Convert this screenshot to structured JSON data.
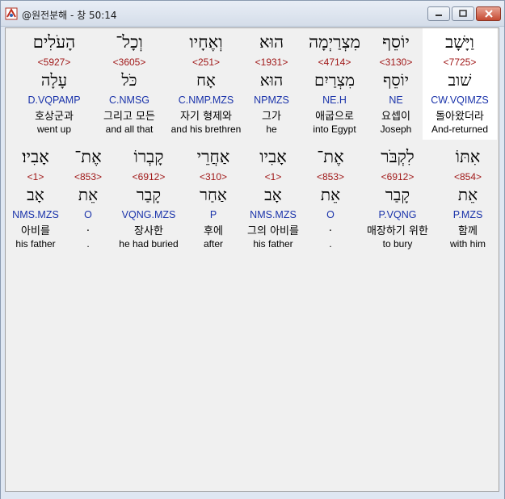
{
  "window": {
    "title": "@원전분해 - 창 50:14",
    "icon": "app-icon",
    "buttons": [
      "minimize",
      "maximize",
      "close"
    ]
  },
  "rows": [
    {
      "cells": [
        {
          "hebrew": "וַיָּשָׁב",
          "strong": "<7725>",
          "lemma": "שׁוב",
          "morph": "CW.VQIMZS",
          "korean": "돌아왔더라",
          "english": "And-returned",
          "selected": true
        },
        {
          "hebrew": "יוֹסֵף",
          "strong": "<3130>",
          "lemma": "יוֹסֵף",
          "morph": "NE",
          "korean": "요셉이",
          "english": "Joseph",
          "selected": false
        },
        {
          "hebrew": "מִצְרַיְמָה",
          "strong": "<4714>",
          "lemma": "מִצְרַיִם",
          "morph": "NE.H",
          "korean": "애굽으로",
          "english": "into Egypt",
          "selected": false
        },
        {
          "hebrew": "הוּא",
          "strong": "<1931>",
          "lemma": "הוּא",
          "morph": "NPMZS",
          "korean": "그가",
          "english": "he",
          "selected": false
        },
        {
          "hebrew": "וְאֶחָיו",
          "strong": "<251>",
          "lemma": "אָח",
          "morph": "C.NMP.MZS",
          "korean": "자기 형제와",
          "english": "and his brethren",
          "selected": false
        },
        {
          "hebrew": "וְכָל־",
          "strong": "<3605>",
          "lemma": "כֹּל",
          "morph": "C.NMSG",
          "korean": "그리고 모든",
          "english": "and all that",
          "selected": false
        },
        {
          "hebrew": "הָעֹלִים",
          "strong": "<5927>",
          "lemma": "עָלָה",
          "morph": "D.VQPAMP",
          "korean": "호상군과",
          "english": "went up",
          "selected": false
        }
      ]
    },
    {
      "cells": [
        {
          "hebrew": "אִתּוֹ",
          "strong": "<854>",
          "lemma": "אֵת",
          "morph": "P.MZS",
          "korean": "함께",
          "english": "with him",
          "selected": false
        },
        {
          "hebrew": "לִקְבֹּר",
          "strong": "<6912>",
          "lemma": "קָבַר",
          "morph": "P.VQNG",
          "korean": "매장하기 위한",
          "english": "to bury",
          "selected": false
        },
        {
          "hebrew": "אֶת־",
          "strong": "<853>",
          "lemma": "אֵת",
          "morph": "O",
          "korean": ".",
          "english": ".",
          "selected": false
        },
        {
          "hebrew": "אָבִיו",
          "strong": "<1>",
          "lemma": "אָב",
          "morph": "NMS.MZS",
          "korean": "그의 아비를",
          "english": "his father",
          "selected": false
        },
        {
          "hebrew": "אַחֲרֵי",
          "strong": "<310>",
          "lemma": "אַחַר",
          "morph": "P",
          "korean": "후에",
          "english": "after",
          "selected": false
        },
        {
          "hebrew": "קָבְרוֹ",
          "strong": "<6912>",
          "lemma": "קָבַר",
          "morph": "VQNG.MZS",
          "korean": "장사한",
          "english": "he had buried",
          "selected": false
        },
        {
          "hebrew": "אֶת־",
          "strong": "<853>",
          "lemma": "אֵת",
          "morph": "O",
          "korean": ".",
          "english": ".",
          "selected": false
        },
        {
          "hebrew": "אָבִיו׃",
          "strong": "<1>",
          "lemma": "אָב",
          "morph": "NMS.MZS",
          "korean": "아비를",
          "english": "his father",
          "selected": false
        }
      ]
    }
  ]
}
